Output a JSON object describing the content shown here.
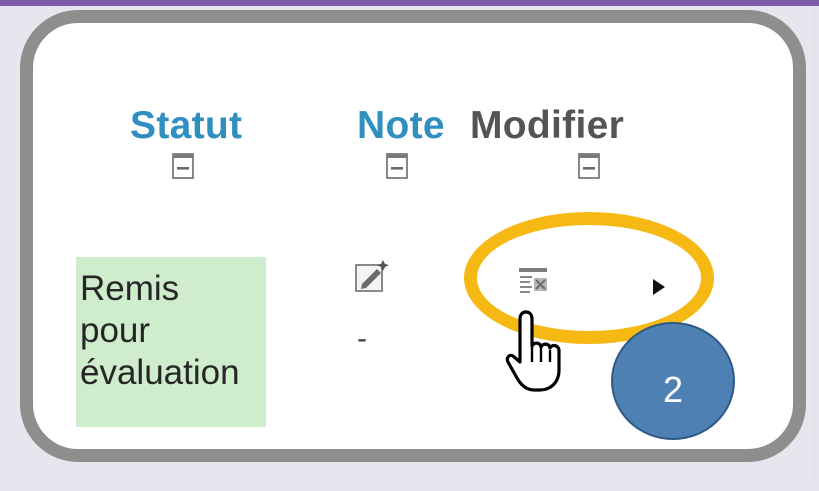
{
  "table": {
    "headers": {
      "status": "Statut",
      "grade": "Note",
      "edit": "Modifier"
    },
    "row": {
      "status": "Remis\npour\névaluation",
      "grade": "-"
    }
  },
  "icons": {
    "collapse": "collapse-column-icon",
    "edit": "edit-grade-icon",
    "list": "edit-submission-icon",
    "arrow": "triangle-right-icon",
    "cursor": "hand-pointer-icon"
  },
  "annotation": {
    "step_number": "2",
    "highlight_color": "#f6b813",
    "badge_color": "#4e80b4"
  },
  "colors": {
    "header_link": "#2f8fc0",
    "header_plain": "#545454",
    "status_bg": "#cfeccc"
  }
}
